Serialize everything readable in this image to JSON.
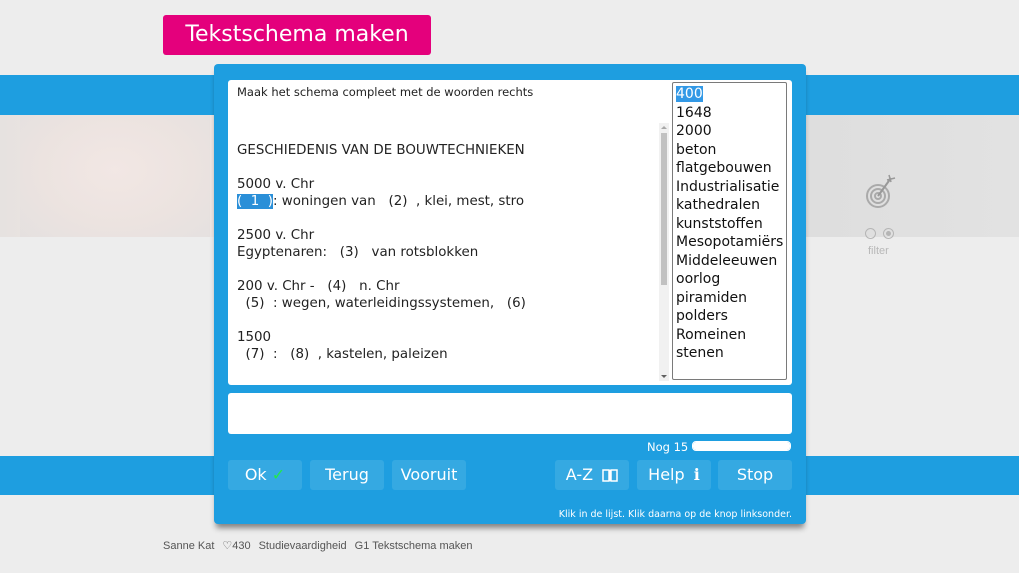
{
  "header": {
    "title": "Tekstschema maken"
  },
  "side": {
    "filter_label": "filter",
    "target_icon": "target-arrow-icon"
  },
  "exercise": {
    "instruction": "Maak het schema compleet met de woorden rechts",
    "scheme_lines": [
      "GESCHIEDENIS VAN DE BOUWTECHNIEKEN",
      "",
      "5000 v. Chr",
      {
        "highlight": "(  1  )",
        "rest": ": woningen van   (2)  , klei, mest, stro"
      },
      "",
      "2500 v. Chr",
      "Egyptenaren:   (3)   van rotsblokken",
      "",
      "200 v. Chr -   (4)   n. Chr",
      "  (5)  : wegen, waterleidingssystemen,   (6)",
      "",
      "1500",
      "  (7)  :   (8)  , kastelen, paleizen"
    ],
    "words": [
      "400",
      "1648",
      "2000",
      "beton",
      "flatgebouwen",
      "Industrialisatie",
      "kathedralen",
      "kunststoffen",
      "Mesopotamiërs",
      "Middeleeuwen",
      "oorlog",
      "piramiden",
      "polders",
      "Romeinen",
      "stenen"
    ],
    "selected_word": "400",
    "answer_value": ""
  },
  "progress": {
    "label": "Nog 15",
    "remaining_fraction": 1.0
  },
  "buttons": {
    "ok": "Ok",
    "terug": "Terug",
    "vooruit": "Vooruit",
    "az": "A-Z",
    "help": "Help",
    "stop": "Stop"
  },
  "hint": "Klik in de lijst. Klik daarna op de knop linksonder.",
  "footer": {
    "user": "Sanne Kat",
    "score": "♡430",
    "subject": "Studievaardigheid",
    "lesson": "G1 Tekstschema maken"
  },
  "colors": {
    "brand_pink": "#e4007c",
    "brand_blue": "#1e9ee0",
    "check_green": "#22e84a"
  }
}
